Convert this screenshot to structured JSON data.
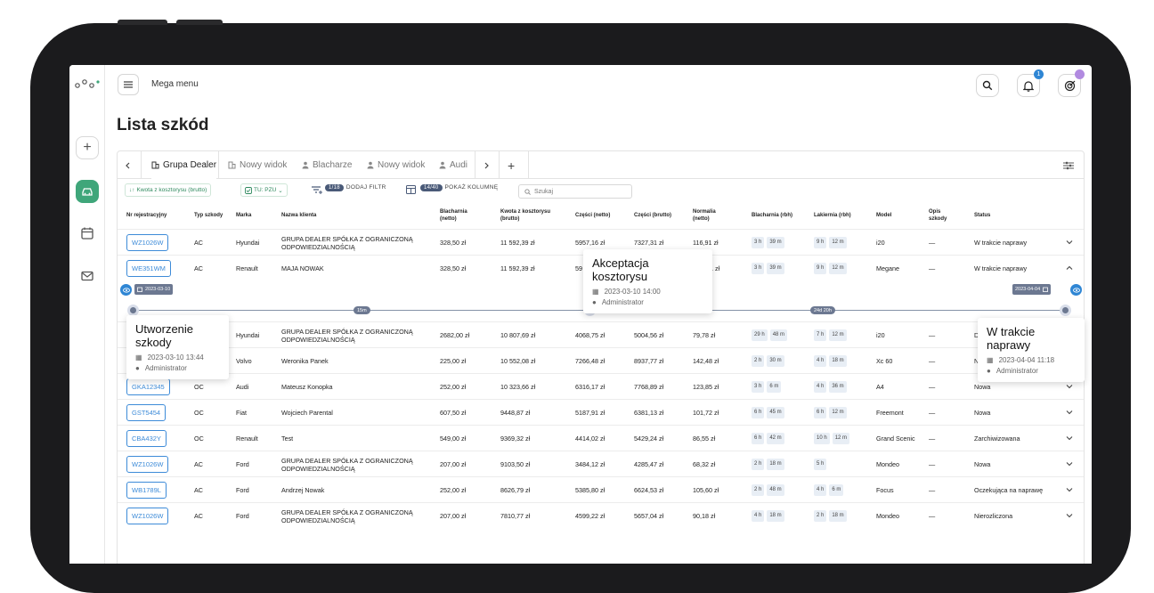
{
  "app": {
    "menu_label": "Mega menu",
    "notifications_count": "1",
    "accent_color": "#3fa67a",
    "link_color": "#3d8bd8"
  },
  "page_title": "Lista szkód",
  "tabs": [
    {
      "label": "Grupa Dealer"
    },
    {
      "label": "Nowy widok"
    },
    {
      "label": "Blacharze"
    },
    {
      "label": "Nowy widok"
    },
    {
      "label": "Audi"
    }
  ],
  "filters": {
    "sort_label": "Kwota z kosztorysu (brutto)",
    "tu_label": "TU: PZU",
    "filter_count": "1/18",
    "add_filter": "DODAJ FILTR",
    "column_count": "14/40",
    "show_column": "POKAŻ KOLUMNĘ",
    "search_placeholder": "Szukaj"
  },
  "columns": [
    "Nr rejestracyjny",
    "Typ szkody",
    "Marka",
    "Nazwa klienta",
    "Blacharnia (netto)",
    "Kwota z kosztorysu (brutto)",
    "Części (netto)",
    "Części (brutto)",
    "Normalia (netto)",
    "Blacharnia (rbh)",
    "Lakiernia (rbh)",
    "Model",
    "Opis szkody",
    "Status"
  ],
  "rows": [
    {
      "plate": "WZ1026W",
      "type": "AC",
      "brand": "Hyundai",
      "client": "GRUPA DEALER SPÓŁKA Z OGRANICZONĄ ODPOWIEDZIALNOŚCIĄ",
      "blach_net": "328,50 zł",
      "amount": "11 592,39 zł",
      "parts_net": "5957,16 zł",
      "parts_gross": "7327,31 zł",
      "norm": "116,91 zł",
      "bh": "3 h",
      "bm": "39 m",
      "lh": "9 h",
      "lm": "12 m",
      "model": "i20",
      "desc": "—",
      "status": "W trakcie naprawy"
    },
    {
      "plate": "WE351WM",
      "type": "AC",
      "brand": "Renault",
      "client": "MAJA NOWAK",
      "blach_net": "328,50 zł",
      "amount": "11 592,39 zł",
      "parts_net": "59",
      "parts_gross": "",
      "norm": "1 zł",
      "bh": "3 h",
      "bm": "39 m",
      "lh": "9 h",
      "lm": "12 m",
      "model": "Megane",
      "desc": "—",
      "status": "W trakcie naprawy"
    },
    {
      "plate": "",
      "type": "",
      "brand": "Hyundai",
      "client": "GRUPA DEALER SPÓŁKA Z OGRANICZONĄ ODPOWIEDZIALNOŚCIĄ",
      "blach_net": "2682,00 zł",
      "amount": "10 807,69 zł",
      "parts_net": "4068,75 zł",
      "parts_gross": "5004,56 zł",
      "norm": "79,78 zł",
      "bh": "29 h",
      "bm": "48 m",
      "lh": "7 h",
      "lm": "12 m",
      "model": "i20",
      "desc": "—",
      "status": "D"
    },
    {
      "plate": "",
      "type": "",
      "brand": "Volvo",
      "client": "Weronika Panek",
      "blach_net": "225,00 zł",
      "amount": "10 552,08 zł",
      "parts_net": "7266,48 zł",
      "parts_gross": "8937,77 zł",
      "norm": "142,48 zł",
      "bh": "2 h",
      "bm": "30 m",
      "lh": "4 h",
      "lm": "18 m",
      "model": "Xc 60",
      "desc": "—",
      "status": "N"
    },
    {
      "plate": "GKA12345",
      "type": "OC",
      "brand": "Audi",
      "client": "Mateusz Konopka",
      "blach_net": "252,00 zł",
      "amount": "10 323,66 zł",
      "parts_net": "6316,17 zł",
      "parts_gross": "7768,89 zł",
      "norm": "123,85 zł",
      "bh": "3 h",
      "bm": "6 m",
      "lh": "4 h",
      "lm": "36 m",
      "model": "A4",
      "desc": "—",
      "status": "Nowa"
    },
    {
      "plate": "GST5454",
      "type": "OC",
      "brand": "Fiat",
      "client": "Wojciech Parental",
      "blach_net": "607,50 zł",
      "amount": "9448,87 zł",
      "parts_net": "5187,91 zł",
      "parts_gross": "6381,13 zł",
      "norm": "101,72 zł",
      "bh": "6 h",
      "bm": "45 m",
      "lh": "6 h",
      "lm": "12 m",
      "model": "Freemont",
      "desc": "—",
      "status": "Nowa"
    },
    {
      "plate": "CBA432Y",
      "type": "OC",
      "brand": "Renault",
      "client": "Test",
      "blach_net": "549,00 zł",
      "amount": "9369,32 zł",
      "parts_net": "4414,02 zł",
      "parts_gross": "5429,24 zł",
      "norm": "86,55 zł",
      "bh": "6 h",
      "bm": "42 m",
      "lh": "10 h",
      "lm": "12 m",
      "model": "Grand Scenic",
      "desc": "—",
      "status": "Zarchiwizowana"
    },
    {
      "plate": "WZ1026W",
      "type": "AC",
      "brand": "Ford",
      "client": "GRUPA DEALER SPÓŁKA Z OGRANICZONĄ ODPOWIEDZIALNOŚCIĄ",
      "blach_net": "207,00 zł",
      "amount": "9103,50 zł",
      "parts_net": "3484,12 zł",
      "parts_gross": "4285,47 zł",
      "norm": "68,32 zł",
      "bh": "2 h",
      "bm": "18 m",
      "lh": "5 h",
      "lm": "",
      "model": "Mondeo",
      "desc": "—",
      "status": "Nowa"
    },
    {
      "plate": "WB1789L",
      "type": "AC",
      "brand": "Ford",
      "client": "Andrzej Nowak",
      "blach_net": "252,00 zł",
      "amount": "8626,79 zł",
      "parts_net": "5385,80 zł",
      "parts_gross": "6624,53 zł",
      "norm": "105,60 zł",
      "bh": "2 h",
      "bm": "48 m",
      "lh": "4 h",
      "lm": "6 m",
      "model": "Focus",
      "desc": "—",
      "status": "Oczekująca na naprawę"
    },
    {
      "plate": "WZ1026W",
      "type": "AC",
      "brand": "Ford",
      "client": "GRUPA DEALER SPÓŁKA Z OGRANICZONĄ ODPOWIEDZIALNOŚCIĄ",
      "blach_net": "207,00 zł",
      "amount": "7810,77 zł",
      "parts_net": "4599,22 zł",
      "parts_gross": "5657,04 zł",
      "norm": "90,18 zł",
      "bh": "4 h",
      "bm": "18 m",
      "lh": "2 h",
      "lm": "18 m",
      "model": "Mondeo",
      "desc": "—",
      "status": "Nierozliczona"
    }
  ],
  "timeline": {
    "start_date": "2023-03-10",
    "end_date": "2023-04-04",
    "gap1": "15m",
    "gap2": "24d 20h",
    "events": [
      {
        "title": "Utworzenie szkody",
        "datetime": "2023-03-10 13:44",
        "user": "Administrator"
      },
      {
        "title": "Akceptacja kosztorysu",
        "datetime": "2023-03-10 14:00",
        "user": "Administrator"
      },
      {
        "title": "W trakcie naprawy",
        "datetime": "2023-04-04 11:18",
        "user": "Administrator"
      }
    ]
  }
}
